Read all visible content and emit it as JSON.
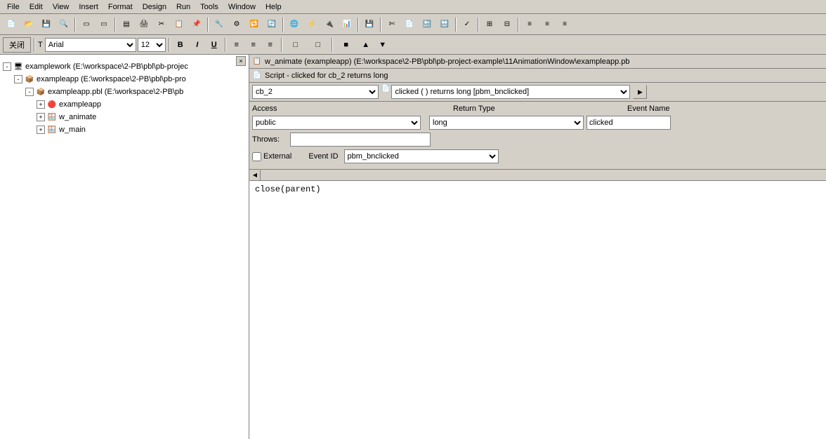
{
  "menubar": {
    "items": [
      "File",
      "Edit",
      "View",
      "Insert",
      "Format",
      "Design",
      "Run",
      "Tools",
      "Window",
      "Help"
    ]
  },
  "format_toolbar": {
    "close_label": "关闭",
    "font_value": "T Arial",
    "font_size_value": "12",
    "bold_label": "B",
    "italic_label": "I",
    "underline_label": "U",
    "align_left": "≡",
    "align_center": "≡",
    "align_right": "≡"
  },
  "title_bar": {
    "icon": "📋",
    "text": "w_animate (exampleapp) (E:\\workspace\\2-PB\\pbl\\pb-project-example\\11AnimationWindow\\exampleapp.pb"
  },
  "script_title": {
    "icon": "📄",
    "text": "Script - clicked for cb_2 returns long"
  },
  "dropdowns": {
    "object_value": "cb_2",
    "event_value": "clicked ( )  returns long [pbm_bnclicked]",
    "extra_btn": "▶"
  },
  "form": {
    "access_label": "Access",
    "return_type_label": "Return Type",
    "event_name_label": "Event Name",
    "access_value": "public",
    "return_type_value": "long",
    "event_name_value": "clicked",
    "throws_label": "Throws:",
    "throws_value": "",
    "external_label": "External",
    "event_id_label": "Event ID",
    "event_id_value": "pbm_bnclicked"
  },
  "code": {
    "lines": [
      "close(parent)"
    ]
  },
  "tree": {
    "close_btn": "×",
    "items": [
      {
        "level": 1,
        "expand": "-",
        "icon": "🖥",
        "label": "examplework (E:\\workspace\\2-PB\\pbl\\pb-projec",
        "type": "workspace"
      },
      {
        "level": 2,
        "expand": "-",
        "icon": "📦",
        "label": "exampleapp (E:\\workspace\\2-PB\\pbl\\pb-pro",
        "type": "target"
      },
      {
        "level": 3,
        "expand": "-",
        "icon": "📦",
        "label": "exampleapp.pbl (E:\\workspace\\2-PB\\pb",
        "type": "library"
      },
      {
        "level": 4,
        "expand": "+",
        "icon": "🔴",
        "label": "exampleapp",
        "type": "app"
      },
      {
        "level": 4,
        "expand": "+",
        "icon": "🪟",
        "label": "w_animate",
        "type": "window"
      },
      {
        "level": 4,
        "expand": "+",
        "icon": "🪟",
        "label": "w_main",
        "type": "window"
      }
    ]
  }
}
